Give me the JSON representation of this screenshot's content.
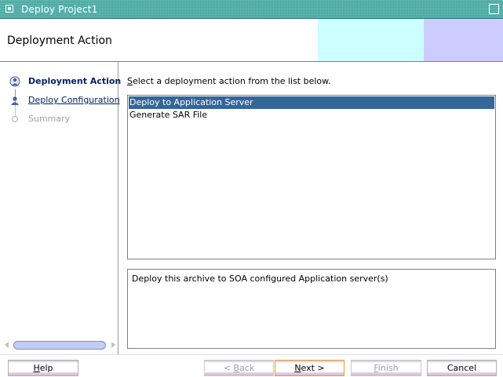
{
  "window": {
    "title": "Deploy Project1"
  },
  "header": {
    "title": "Deployment Action"
  },
  "steps": [
    {
      "label": "Deployment Action",
      "state": "active"
    },
    {
      "label": "Deploy Configuration",
      "state": "link"
    },
    {
      "label": "Summary",
      "state": "disabled"
    }
  ],
  "main": {
    "instruction_first": "S",
    "instruction_rest": "elect a deployment action from the list below.",
    "actions": [
      {
        "label": "Deploy to Application Server",
        "selected": true
      },
      {
        "label": "Generate SAR File",
        "selected": false
      }
    ],
    "description": "Deploy this archive to SOA configured Application server(s)"
  },
  "buttons": {
    "help": {
      "mnemonic": "H",
      "rest": "elp"
    },
    "back": {
      "pre": "< ",
      "mnemonic": "B",
      "rest": "ack"
    },
    "next": {
      "mnemonic": "N",
      "rest": "ext >"
    },
    "finish": {
      "mnemonic": "F",
      "rest": "inish"
    },
    "cancel": {
      "label": "Cancel"
    }
  },
  "colors": {
    "titlebar": "#3aa39c",
    "header_cyan": "#ccffff",
    "header_lavender": "#ccccff",
    "selection": "#336699",
    "active_step_text": "#002266"
  },
  "icons": {
    "window": "window-icon",
    "close": "close-box-icon",
    "step_active": "step-active-icon",
    "step_link": "step-pending-icon",
    "step_disabled": "step-disabled-icon"
  }
}
